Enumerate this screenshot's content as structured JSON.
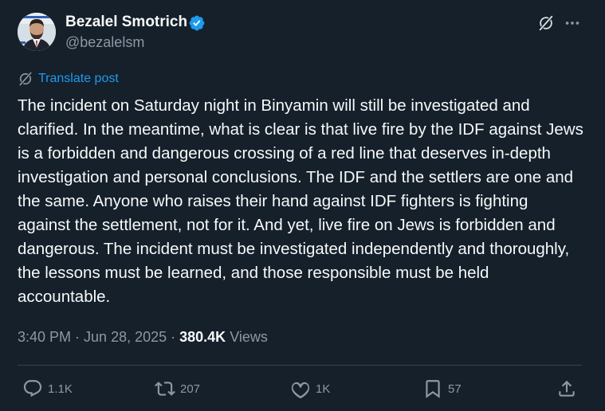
{
  "author": {
    "name": "Bezalel Smotrich",
    "handle": "@bezalelsm",
    "verified": true
  },
  "translate_label": "Translate post",
  "text": "The incident on Saturday night in Binyamin will still be investigated and clarified. In the meantime, what is clear is that live fire by the IDF against Jews is a forbidden and dangerous crossing of a red line that deserves in-depth investigation and personal conclusions. The IDF and the settlers are one and the same. Anyone who raises their hand against IDF fighters is fighting against the settlement, not for it. And yet, live fire on Jews is forbidden and dangerous. The incident must be investigated independently and thoroughly, the lessons must be learned, and those responsible must be held accountable.",
  "meta": {
    "time": "3:40 PM",
    "date": "Jun 28, 2025",
    "separator": "·",
    "views_count": "380.4K",
    "views_label": "Views"
  },
  "actions": {
    "replies": "1.1K",
    "reposts": "207",
    "likes": "1K",
    "bookmarks": "57"
  },
  "icons": {
    "verified": "verified-badge-icon",
    "grok": "grok-icon",
    "more": "more-icon",
    "translate": "translate-icon",
    "reply": "reply-icon",
    "repost": "repost-icon",
    "like": "heart-icon",
    "bookmark": "bookmark-icon",
    "share": "share-icon"
  },
  "colors": {
    "background": "#15202b",
    "primary_text": "#f7f9f9",
    "secondary_text": "#8b98a5",
    "accent": "#1d9bf0",
    "divider": "#38444d"
  }
}
